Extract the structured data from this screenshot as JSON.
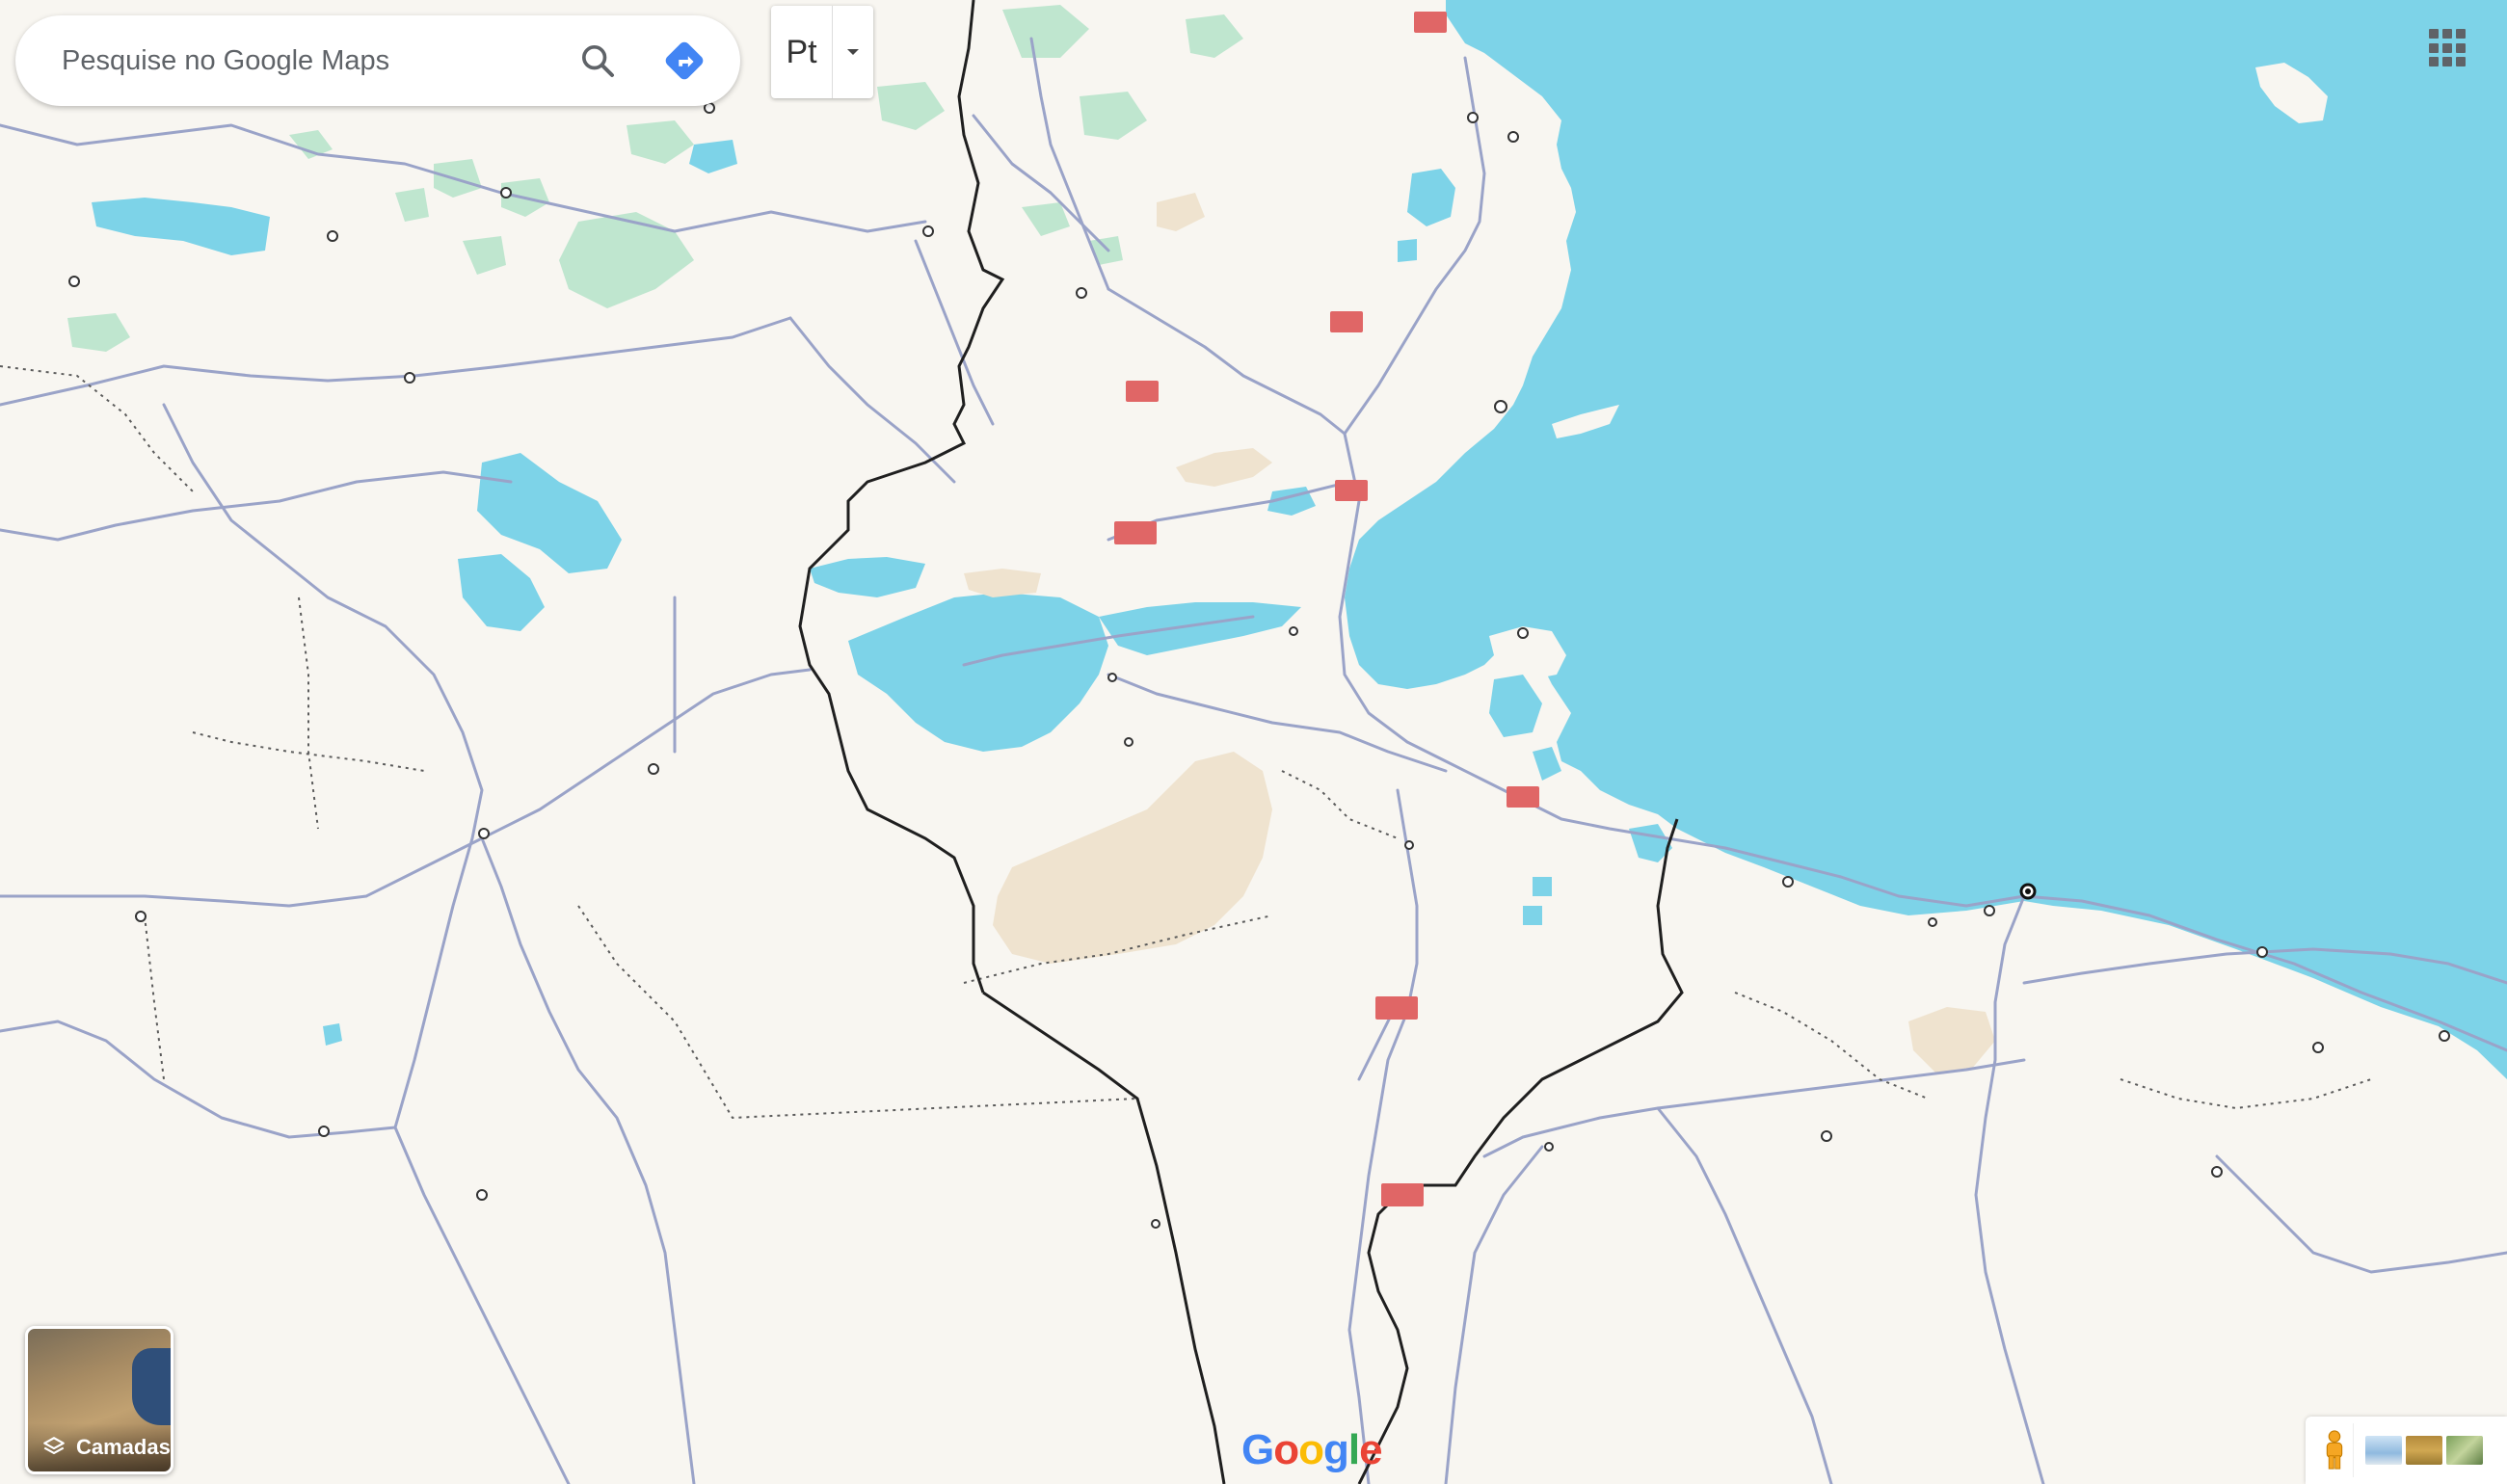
{
  "search": {
    "placeholder": "Pesquise no Google Maps"
  },
  "language_control": {
    "label": "Pt",
    "dropdown": "chevron-down-icon"
  },
  "layers": {
    "label": "Camadas"
  },
  "logo": {
    "letters": [
      "G",
      "o",
      "o",
      "g",
      "l",
      "e"
    ],
    "colors": [
      "#4285F4",
      "#EA4335",
      "#FBBC05",
      "#4285F4",
      "#34A853",
      "#EA4335"
    ]
  },
  "colors": {
    "water": "#7dd3e8",
    "land": "#f8f6f1",
    "road": "#9aa3c8",
    "border": "#1f1f1f",
    "highway_shield": "#e06666",
    "forest": "#bfe6cf",
    "sand": "#efe3cf",
    "accent": "#4285F4"
  },
  "icons": [
    "search-icon",
    "directions-icon",
    "apps-grid-icon",
    "layers-icon",
    "pegman-icon"
  ]
}
